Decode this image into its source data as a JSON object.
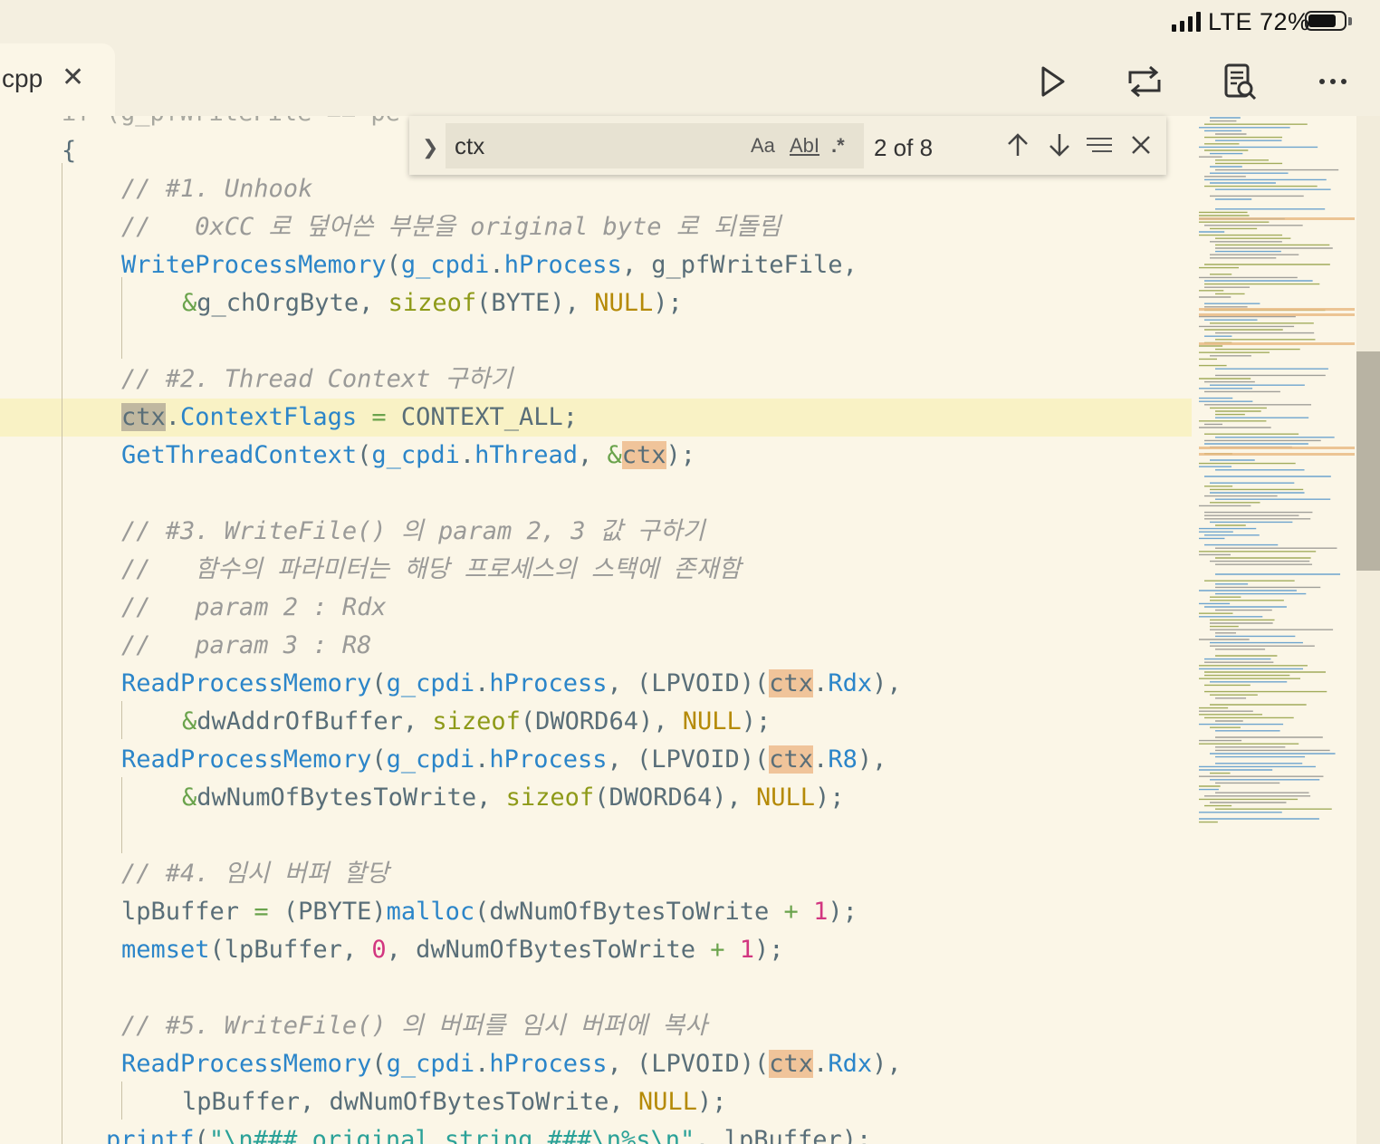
{
  "status_bar": {
    "carrier": "LTE",
    "battery": "72%"
  },
  "tab": {
    "label": "cpp",
    "close": "✕"
  },
  "toolbar": {
    "run": "run-icon",
    "compare": "compare-icon",
    "preview": "preview-icon",
    "more": "more-icon"
  },
  "find": {
    "query": "ctx",
    "match_case": "Aa",
    "whole_word": "AbI",
    "regex": ".*",
    "count": "2 of 8"
  },
  "code": [
    "if (g_pfWriteFile == pe",
    "{",
    "// #1. Unhook",
    "//   0xCC 로 덮어쓴 부분을 original byte 로 되돌림",
    "WriteProcessMemory(g_cpdi.hProcess, g_pfWriteFile,",
    "&g_chOrgByte, sizeof(BYTE), NULL);",
    "",
    "// #2. Thread Context 구하기",
    "ctx.ContextFlags = CONTEXT_ALL;",
    "GetThreadContext(g_cpdi.hThread, &ctx);",
    "",
    "// #3. WriteFile() 의 param 2, 3 값 구하기",
    "//   함수의 파라미터는 해당 프로세스의 스택에 존재함",
    "//   param 2 : Rdx",
    "//   param 3 : R8",
    "ReadProcessMemory(g_cpdi.hProcess, (LPVOID)(ctx.Rdx),",
    "&dwAddrOfBuffer, sizeof(DWORD64), NULL);",
    "ReadProcessMemory(g_cpdi.hProcess, (LPVOID)(ctx.R8),",
    "&dwNumOfBytesToWrite, sizeof(DWORD64), NULL);",
    "",
    "// #4. 임시 버퍼 할당",
    "lpBuffer = (PBYTE)malloc(dwNumOfBytesToWrite + 1);",
    "memset(lpBuffer, 0, dwNumOfBytesToWrite + 1);",
    "",
    "// #5. WriteFile() 의 버퍼를 임시 버퍼에 복사",
    "ReadProcessMemory(g_cpdi.hProcess, (LPVOID)(ctx.Rdx),",
    "lpBuffer, dwNumOfBytesToWrite, NULL);",
    "printf(\"\\n### original string ###\\n%s\\n\", lpBuffer);"
  ]
}
